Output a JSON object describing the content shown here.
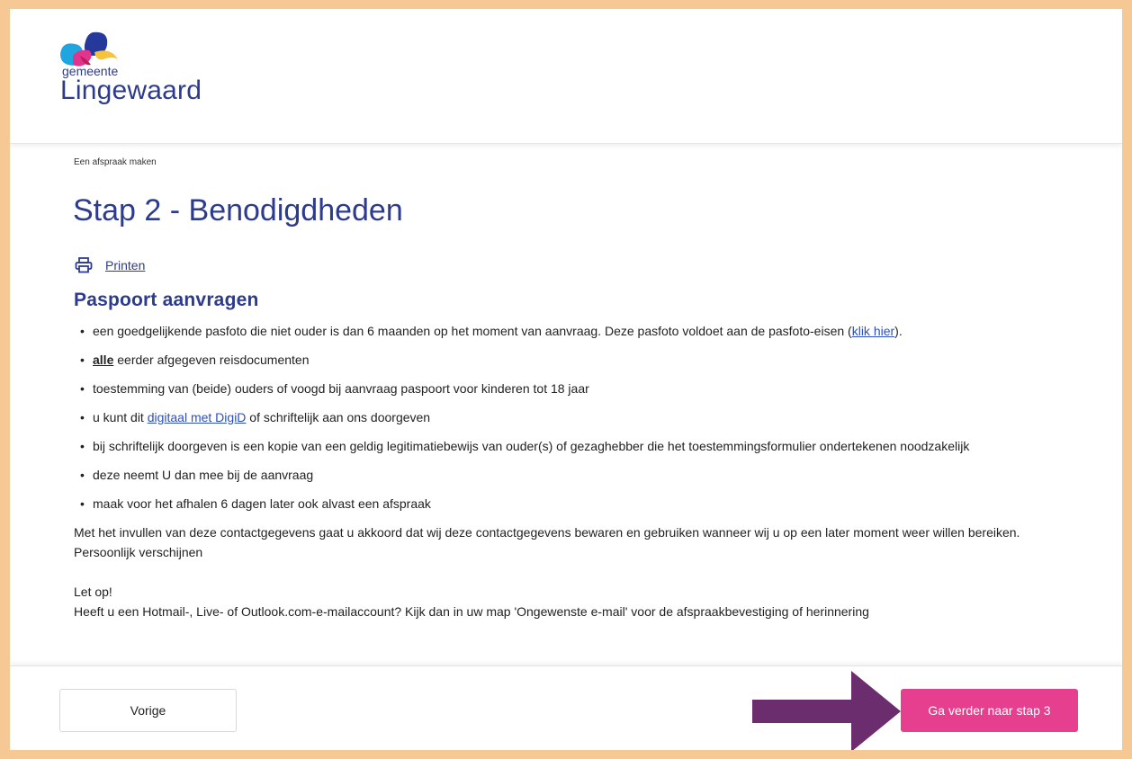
{
  "header": {
    "logo_small": "gemeente",
    "logo_big": "Lingewaard"
  },
  "breadcrumb": "Een afspraak maken",
  "page_title": "Stap 2 - Benodigdheden",
  "print_label": "Printen",
  "section_title": "Paspoort aanvragen",
  "bullets": {
    "b1_text": "een goedgelijkende pasfoto die niet ouder is dan 6 maanden op het moment van aanvraag. Deze pasfoto voldoet aan de pasfoto-eisen (",
    "b1_link": "klik hier",
    "b1_end": ").",
    "b2_bold": "alle",
    "b2_text": " eerder afgegeven reisdocumenten",
    "b3_text": "toestemming van (beide) ouders of voogd bij aanvraag paspoort voor kinderen tot 18 jaar",
    "b4_pre": "u kunt dit ",
    "b4_link": "digitaal met DigiD",
    "b4_post": " of schriftelijk aan ons doorgeven",
    "b5_text": "bij schriftelijk doorgeven is een kopie van een geldig legitimatiebewijs van ouder(s) of gezaghebber die het toestemmingsformulier ondertekenen noodzakelijk",
    "b6_text": "deze neemt U dan mee bij de aanvraag",
    "b7_text": "maak voor het afhalen 6 dagen later ook alvast een afspraak"
  },
  "paragraph": {
    "consent": "Met het invullen van deze contactgegevens gaat u akkoord dat wij deze contactgegevens bewaren en gebruiken wanneer wij u op een later moment weer willen bereiken.",
    "appear": "Persoonlijk verschijnen",
    "notice_title": "Let op!",
    "notice_text": "Heeft u een Hotmail-, Live- of Outlook.com-e-mailaccount? Kijk dan in uw map 'Ongewenste e-mail' voor de afspraakbevestiging of herinnering"
  },
  "footer": {
    "prev_label": "Vorige",
    "next_label": "Ga verder naar stap 3"
  },
  "colors": {
    "background_border": "#f6c994",
    "brand_blue": "#2d3b8e",
    "link_blue": "#2d4fbf",
    "primary_button": "#e63f8f",
    "arrow": "#6b2d6e"
  }
}
